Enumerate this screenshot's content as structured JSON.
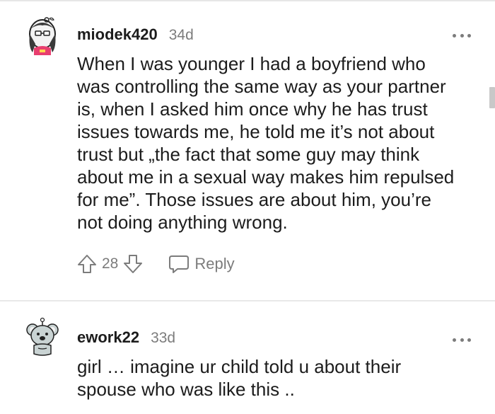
{
  "comments": [
    {
      "username": "miodek420",
      "age": "34d",
      "body_lines": [
        "When I was younger I had a boyfriend who",
        "was controlling the same way as your partner",
        "is, when I asked him once why he has trust",
        "issues towards me, he told me it’s not about",
        "trust but „the fact that some guy may think",
        "about me in a sexual way makes him repulsed",
        "for me”. Those issues are about him, you’re",
        "not doing anything wrong."
      ],
      "vote_count": "28",
      "reply_label": "Reply",
      "avatar_icon": "snoo-avatar-icon"
    },
    {
      "username": "ework22",
      "age": "33d",
      "body_lines": [
        "girl … imagine ur child told u about their",
        "spouse who was like this .."
      ],
      "avatar_icon": "snoo-avatar-icon"
    }
  ],
  "colors": {
    "text": "#1c1c1c",
    "muted": "#7c7c7c",
    "divider": "#e8e8e8"
  }
}
